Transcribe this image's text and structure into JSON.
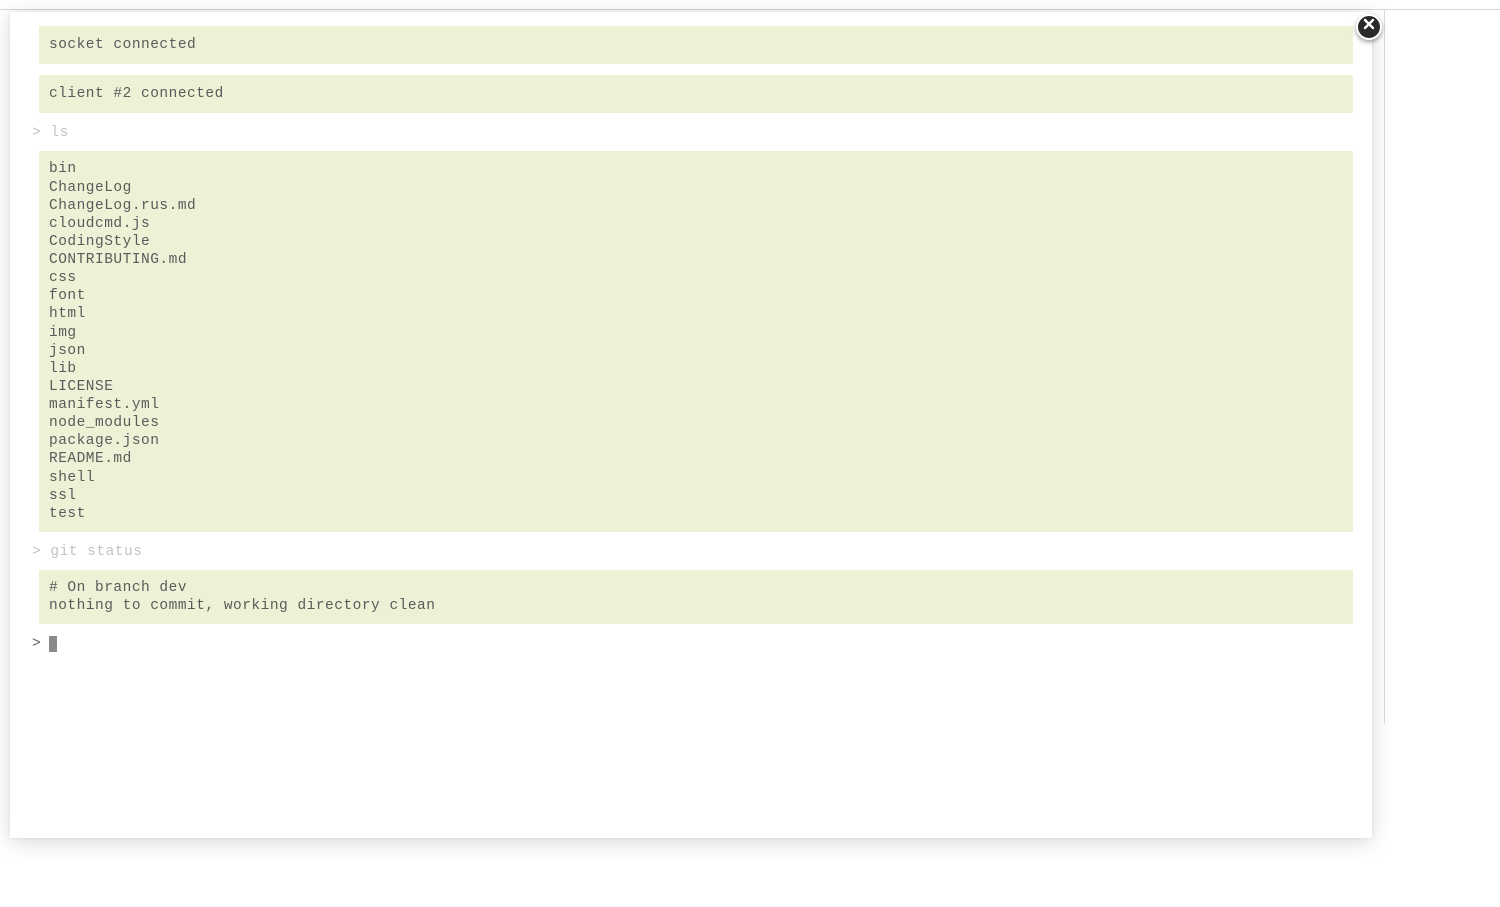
{
  "status": [
    "socket connected",
    "client #2 connected"
  ],
  "prompt_symbol": ">",
  "entries": [
    {
      "cmd": "ls",
      "output": "bin\nChangeLog\nChangeLog.rus.md\ncloudcmd.js\nCodingStyle\nCONTRIBUTING.md\ncss\nfont\nhtml\nimg\njson\nlib\nLICENSE\nmanifest.yml\nnode_modules\npackage.json\nREADME.md\nshell\nssl\ntest"
    },
    {
      "cmd": "git status",
      "output": "# On branch dev\nnothing to commit, working directory clean"
    }
  ],
  "input_value": ""
}
